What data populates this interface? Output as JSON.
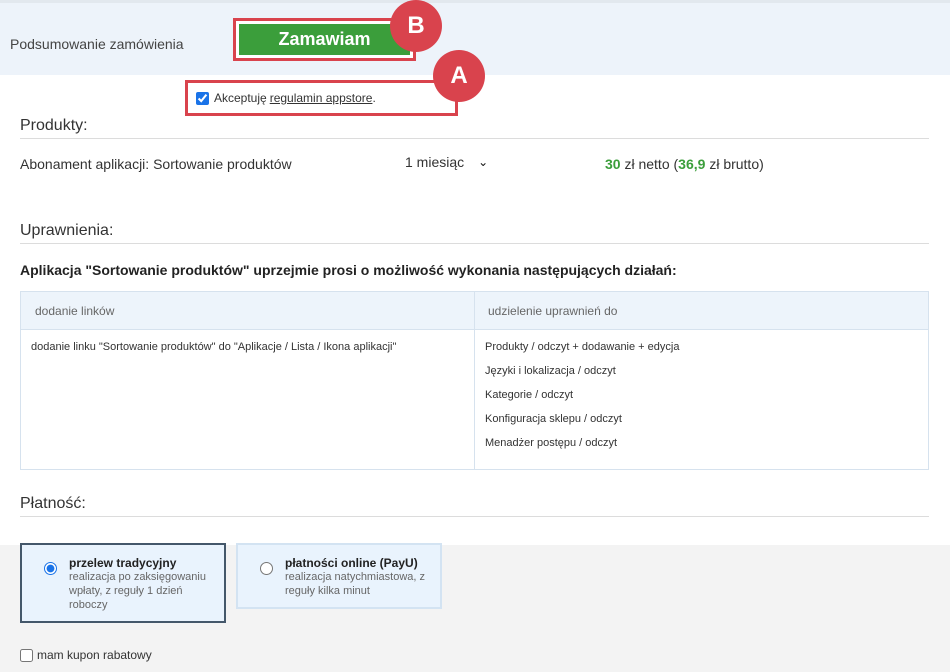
{
  "header": {
    "title": "Podsumowanie zamówienia",
    "order_button": "Zamawiam",
    "marker_b": "B",
    "marker_a": "A"
  },
  "terms": {
    "accept_prefix": "Akceptuję",
    "link": "regulamin appstore",
    "suffix": "."
  },
  "products": {
    "heading": "Produkty:",
    "name": "Abonament aplikacji: Sortowanie produktów",
    "period": "1 miesiąc",
    "price_net": "30",
    "price_net_label": "zł netto (",
    "price_gross": "36,9",
    "price_gross_label": "zł brutto)"
  },
  "permissions": {
    "heading": "Uprawnienia:",
    "request": "Aplikacja \"Sortowanie produktów\" uprzejmie prosi o możliwość wykonania następujących działań:",
    "col_links": "dodanie linków",
    "col_grants": "udzielenie uprawnień do",
    "link_entry": "dodanie linku \"Sortowanie produktów\" do \"Aplikacje / Lista / Ikona aplikacji\"",
    "grants": [
      "Produkty / odczyt + dodawanie + edycja",
      "Języki i lokalizacja / odczyt",
      "Kategorie / odczyt",
      "Konfiguracja sklepu / odczyt",
      "Menadżer postępu / odczyt"
    ]
  },
  "payment": {
    "heading": "Płatność:",
    "options": [
      {
        "title": "przelew tradycyjny",
        "desc": "realizacja po zaksięgowaniu wpłaty, z reguły 1 dzień roboczy",
        "selected": true
      },
      {
        "title": "płatności online (PayU)",
        "desc": "realizacja natychmiastowa, z reguły kilka minut",
        "selected": false
      }
    ],
    "coupon": "mam kupon rabatowy"
  },
  "colors": {
    "accent_green": "#3b9e3b",
    "marker_red": "#d9434d",
    "header_bg": "#edf3fa"
  }
}
